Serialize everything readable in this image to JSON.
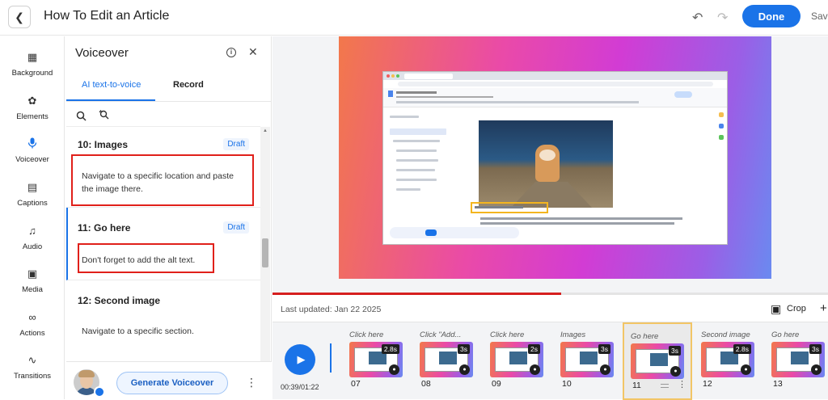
{
  "header": {
    "title": "How To Edit an Article",
    "done_label": "Done",
    "save_label": "Save"
  },
  "leftnav": {
    "items": [
      {
        "label": "Background",
        "icon": "background-icon"
      },
      {
        "label": "Elements",
        "icon": "elements-icon"
      },
      {
        "label": "Voiceover",
        "icon": "microphone-icon"
      },
      {
        "label": "Captions",
        "icon": "captions-icon"
      },
      {
        "label": "Audio",
        "icon": "music-note-icon"
      },
      {
        "label": "Media",
        "icon": "image-icon"
      },
      {
        "label": "Actions",
        "icon": "link-icon"
      },
      {
        "label": "Transitions",
        "icon": "transitions-icon"
      }
    ],
    "active": "Voiceover"
  },
  "panel": {
    "title": "Voiceover",
    "tabs": [
      "AI text-to-voice",
      "Record"
    ],
    "active_tab": "AI text-to-voice",
    "items": [
      {
        "title": "10: Images",
        "badge": "Draft",
        "text": "Navigate to a specific location and paste the image there."
      },
      {
        "title": "11: Go here",
        "badge": "Draft",
        "text": "Don't forget to add the alt text."
      },
      {
        "title": "12: Second image",
        "badge": "",
        "text": "Navigate to a specific section."
      }
    ],
    "generate_label": "Generate Voiceover"
  },
  "player": {
    "progress": 0.52,
    "last_updated": "Last updated: Jan 22 2025",
    "crop_label": "Crop",
    "time": "00:39/01:22"
  },
  "timeline": {
    "clips": [
      {
        "caption": "Click here",
        "duration": "2.8s",
        "number": "07"
      },
      {
        "caption": "Click \"Add...",
        "duration": "3s",
        "number": "08"
      },
      {
        "caption": "Click here",
        "duration": "2s",
        "number": "09"
      },
      {
        "caption": "Images",
        "duration": "3s",
        "number": "10"
      },
      {
        "caption": "Go here",
        "duration": "3s",
        "number": "11",
        "active": true
      },
      {
        "caption": "Second image",
        "duration": "2.8s",
        "number": "12"
      },
      {
        "caption": "Go here",
        "duration": "3s",
        "number": "13"
      }
    ]
  },
  "colors": {
    "accent": "#1a73e8",
    "highlight_red": "#e0201a",
    "highlight_yellow": "#f3b51f"
  }
}
